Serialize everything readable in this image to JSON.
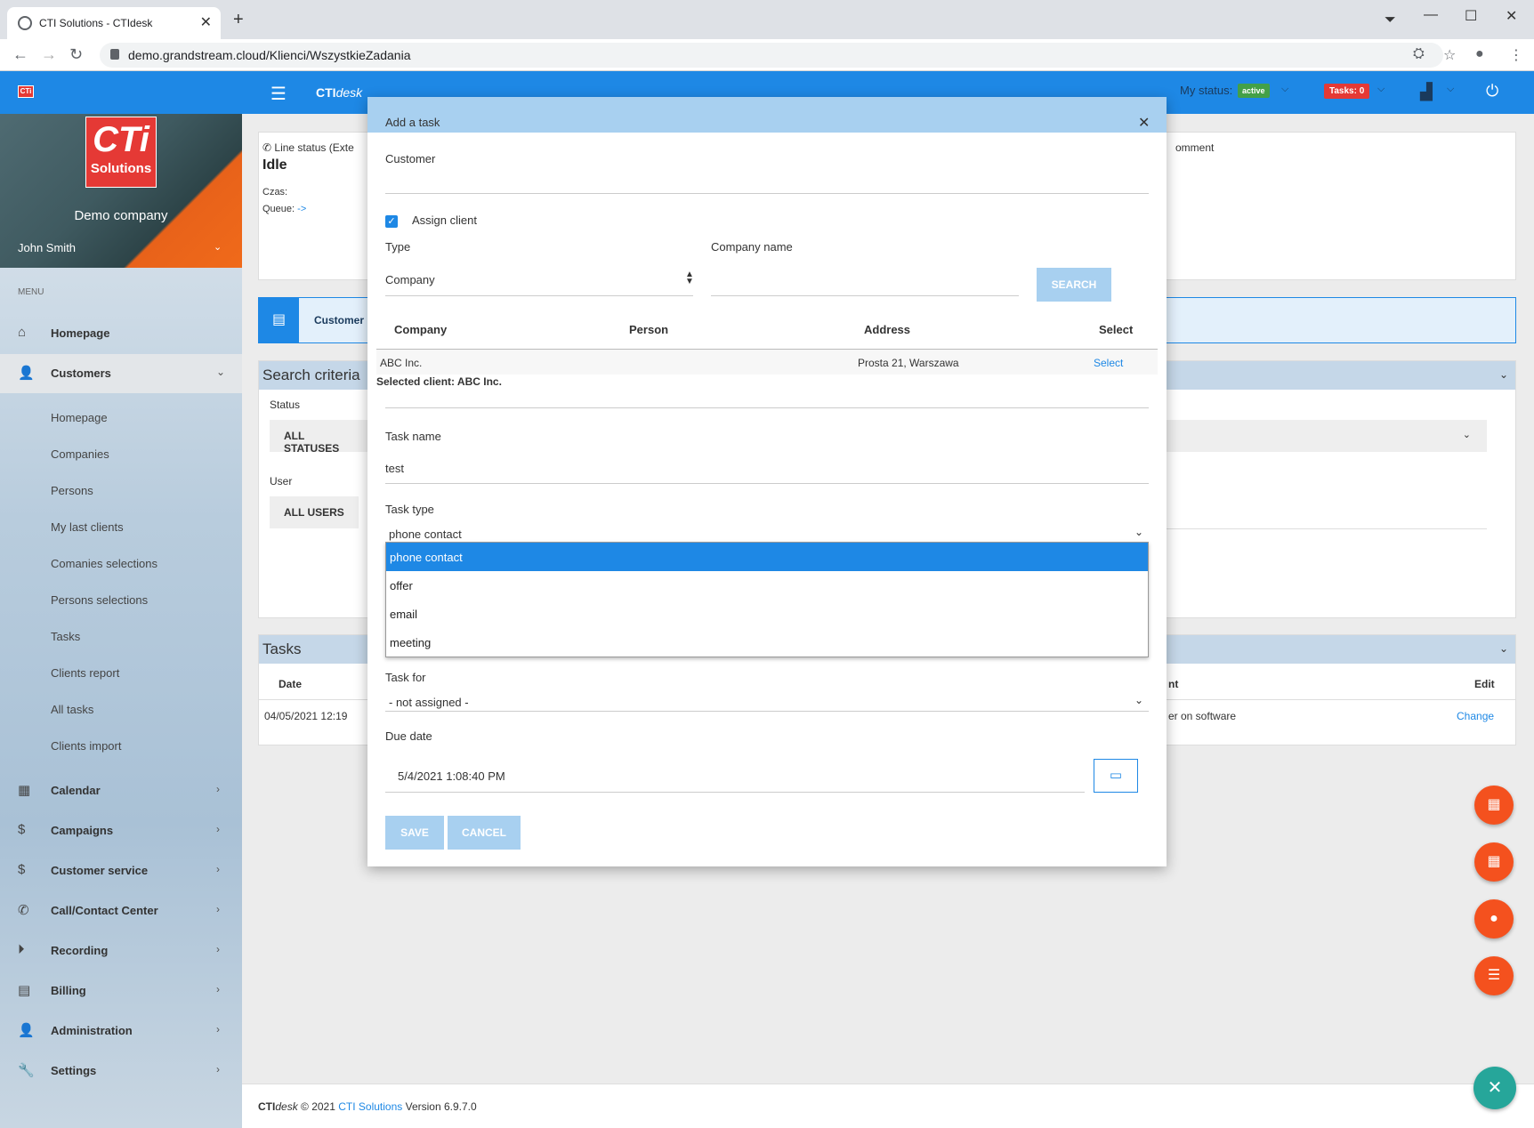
{
  "browser": {
    "tab_title": "CTI Solutions - CTIdesk",
    "url": "demo.grandstream.cloud/Klienci/WszystkieZadania"
  },
  "header": {
    "logo_small": "CTi",
    "brand_bold": "CTI",
    "brand_italic": "desk",
    "my_status_label": "My status:",
    "status_badge": "active",
    "tasks_badge": "Tasks: 0"
  },
  "sidebar": {
    "logo_line1": "CTi",
    "logo_line2": "Solutions",
    "company": "Demo company",
    "user": "John Smith",
    "menu_label": "MENU",
    "items": [
      {
        "label": "Homepage"
      },
      {
        "label": "Customers"
      },
      {
        "label": "Calendar"
      },
      {
        "label": "Campaigns"
      },
      {
        "label": "Customer service"
      },
      {
        "label": "Call/Contact Center"
      },
      {
        "label": "Recording"
      },
      {
        "label": "Billing"
      },
      {
        "label": "Administration"
      },
      {
        "label": "Settings"
      }
    ],
    "customer_sub": [
      "Homepage",
      "Companies",
      "Persons",
      "My last clients",
      "Comanies selections",
      "Persons selections",
      "Tasks",
      "Clients report",
      "All tasks",
      "Clients import"
    ]
  },
  "main": {
    "line_status": "Line status (Exte",
    "line_state": "Idle",
    "czas": "Czas:",
    "queue": "Queue:",
    "queue_link": "->",
    "comment": "omment",
    "customer_bar": "Customer",
    "search_title": "Search criteria",
    "status_label": "Status",
    "status_value": "ALL STATUSES",
    "user_label": "User",
    "user_value": "ALL USERS",
    "tasks_title": "Tasks",
    "tasks_headers": {
      "date": "Date",
      "nt": "nt",
      "edit": "Edit"
    },
    "tasks_row": {
      "date": "04/05/2021 12:19",
      "desc": "er on software",
      "action": "Change"
    }
  },
  "footer": {
    "brand_bold": "CTI",
    "brand_italic": "desk",
    "copy": " © 2021 ",
    "link": "CTI Solutions",
    "version": " Version 6.9.7.0"
  },
  "modal": {
    "title": "Add a task",
    "customer_label": "Customer",
    "assign_client_label": "Assign client",
    "type_label": "Type",
    "type_value": "Company",
    "company_name_label": "Company name",
    "search_button": "SEARCH",
    "table_headers": [
      "Company",
      "Person",
      "Address",
      "Select"
    ],
    "client_row": {
      "company": "ABC Inc.",
      "person": "",
      "address": "Prosta 21, Warszawa",
      "select": "Select"
    },
    "selected_client": "Selected client: ABC Inc.",
    "task_name_label": "Task name",
    "task_name_value": "test",
    "task_type_label": "Task type",
    "task_type_value": "phone contact",
    "task_type_options": [
      "phone contact",
      "offer",
      "email",
      "meeting"
    ],
    "task_for_label": "Task for",
    "task_for_value": "- not assigned -",
    "due_date_label": "Due date",
    "due_date_value": "5/4/2021 1:08:40 PM",
    "save_button": "SAVE",
    "cancel_button": "CANCEL"
  },
  "colors": {
    "primary": "#1e88e5",
    "status_active": "#43a047",
    "tasks_badge": "#e53935",
    "fab": "#f4511e",
    "fab_close": "#26a69a"
  }
}
